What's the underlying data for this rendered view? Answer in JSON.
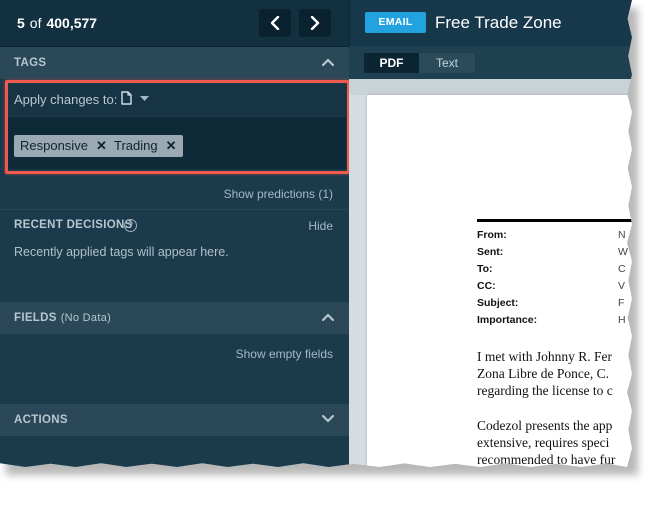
{
  "nav": {
    "current": "5",
    "of_label": "of",
    "total": "400,577",
    "prev_icon": "chevron-left-icon",
    "next_icon": "chevron-right-icon"
  },
  "tags": {
    "title": "TAGS",
    "apply_label": "Apply changes to:",
    "applied": [
      "Responsive",
      "Trading"
    ],
    "show_predictions": "Show predictions (1)"
  },
  "recent": {
    "title": "RECENT DECISIONS",
    "hide_label": "Hide",
    "empty_text": "Recently applied tags will appear here."
  },
  "fields": {
    "title": "FIELDS",
    "subtitle": "(No Data)",
    "show_empty": "Show empty fields"
  },
  "actions": {
    "title": "ACTIONS"
  },
  "document": {
    "badge": "EMAIL",
    "title": "Free Trade Zone",
    "view_tabs": [
      "PDF",
      "Text"
    ],
    "header_labels": [
      "From:",
      "Sent:",
      "To:",
      "CC:",
      "Subject:",
      "Importance:"
    ],
    "header_values": [
      "N",
      "W",
      "C",
      "V",
      "F",
      "H"
    ],
    "body_lines": [
      "I met with Johnny R. Fer",
      "Zona Libre de Ponce, C.",
      "regarding the license to c",
      "Codezol presents the app",
      "extensive, requires speci",
      "recommended to have fur"
    ]
  },
  "colors": {
    "accent": "#22a3e0",
    "highlight": "#ef5a4f",
    "panel": "#1b3a4c"
  }
}
